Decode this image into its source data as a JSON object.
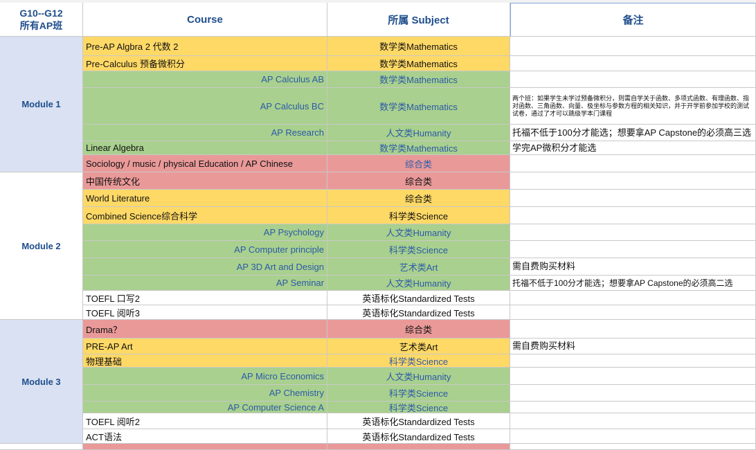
{
  "header": {
    "corner_line1": "G10--G12",
    "corner_line2": "所有AP班",
    "course": "Course",
    "subject": "所属 Subject",
    "notes": "备注"
  },
  "modules": [
    "Module 1",
    "Module 2",
    "Module 3"
  ],
  "rows": [
    {
      "course": "Pre-AP Algbra 2 代数 2",
      "subject": "数学类Mathematics",
      "note": "",
      "color": "orange",
      "align": "left",
      "module": 0
    },
    {
      "course": "Pre-Calculus 预备微积分",
      "subject": "数学类Mathematics",
      "note": "",
      "color": "orange",
      "align": "left",
      "module": 0
    },
    {
      "course": "AP Calculus AB",
      "subject": "数学类Mathematics",
      "note": "",
      "color": "green",
      "align": "right",
      "module": 0
    },
    {
      "course": "AP Calculus BC",
      "subject": "数学类Mathematics",
      "note": "两个班：如果学生未学过预备微积分，则需自学关于函数、多项式函数、有理函数、指对函数、三角函数、向量、极坐标与参数方程的相关知识，并于开学前参加学校的测试试卷，通过了才可以跳级学本门课程",
      "color": "green",
      "align": "right",
      "module": 0
    },
    {
      "course": "AP Research",
      "subject": "人文类Humanity",
      "note": "托福不低于100分才能选；想要拿AP Capstone的必须高三选",
      "color": "green",
      "align": "right",
      "module": 0
    },
    {
      "course": "Linear Algebra",
      "subject": "数学类Mathematics",
      "note": "学完AP微积分才能选",
      "color": "green",
      "align": "left",
      "module": 0
    },
    {
      "course": "Sociology / music / physical Education / AP Chinese",
      "subject": "综合类",
      "note": "",
      "color": "red",
      "align": "left",
      "module": 0
    },
    {
      "course": "中国传统文化",
      "subject": "综合类",
      "note": "",
      "color": "red",
      "align": "left",
      "module": 1
    },
    {
      "course": "World Literature",
      "subject": "综合类",
      "note": "",
      "color": "orange",
      "align": "left",
      "module": 1
    },
    {
      "course": "Combined Science综合科学",
      "subject": "科学类Science",
      "note": "",
      "color": "orange",
      "align": "left",
      "module": 1
    },
    {
      "course": "AP Psychology",
      "subject": "人文类Humanity",
      "note": "",
      "color": "green",
      "align": "right",
      "module": 1
    },
    {
      "course": "AP Computer principle",
      "subject": "科学类Science",
      "note": "",
      "color": "green",
      "align": "right",
      "module": 1
    },
    {
      "course": "AP 3D Art and Design",
      "subject": "艺术类Art",
      "note": "需自费购买材料",
      "color": "green",
      "align": "right",
      "module": 1
    },
    {
      "course": "AP Seminar",
      "subject": "人文类Humanity",
      "note": "托福不低于100分才能选；想要拿AP Capstone的必须高二选",
      "color": "green",
      "align": "right",
      "module": 1
    },
    {
      "course": "TOEFL 口写2",
      "subject": "英语标化Standardized Tests",
      "note": "",
      "color": "white",
      "align": "left",
      "module": 1
    },
    {
      "course": "TOEFL 阅听3",
      "subject": "英语标化Standardized Tests",
      "note": "",
      "color": "white",
      "align": "left",
      "module": 1
    },
    {
      "course": "Drama？",
      "subject": "综合类",
      "note": "",
      "color": "red",
      "align": "left",
      "module": 2
    },
    {
      "course": "PRE-AP Art",
      "subject": "艺术类Art",
      "note": "需自费购买材料",
      "color": "orange",
      "align": "left",
      "module": 2
    },
    {
      "course": "物理基础",
      "subject": "科学类Science",
      "note": "",
      "color": "orange",
      "align": "left",
      "module": 2
    },
    {
      "course": "AP Micro Economics",
      "subject": "人文类Humanity",
      "note": "",
      "color": "green",
      "align": "right",
      "module": 2
    },
    {
      "course": "AP Chemistry",
      "subject": "科学类Science",
      "note": "",
      "color": "green",
      "align": "right",
      "module": 2
    },
    {
      "course": "AP Computer Science A",
      "subject": "科学类Science",
      "note": "",
      "color": "green",
      "align": "right",
      "module": 2
    },
    {
      "course": "TOEFL 阅听2",
      "subject": "英语标化Standardized Tests",
      "note": "",
      "color": "white",
      "align": "left",
      "module": 2
    },
    {
      "course": "ACT语法",
      "subject": "英语标化Standardized Tests",
      "note": "",
      "color": "white",
      "align": "left",
      "module": 2
    },
    {
      "course": "",
      "subject": "",
      "note": "",
      "color": "red",
      "align": "left",
      "module": 3
    }
  ],
  "colors": {
    "orange": "#ffd966",
    "green": "#a9d08e",
    "red": "#ea9999",
    "white": "#ffffff",
    "module_bg": "#d9e1f2",
    "header_text": "#1f4e8c"
  }
}
